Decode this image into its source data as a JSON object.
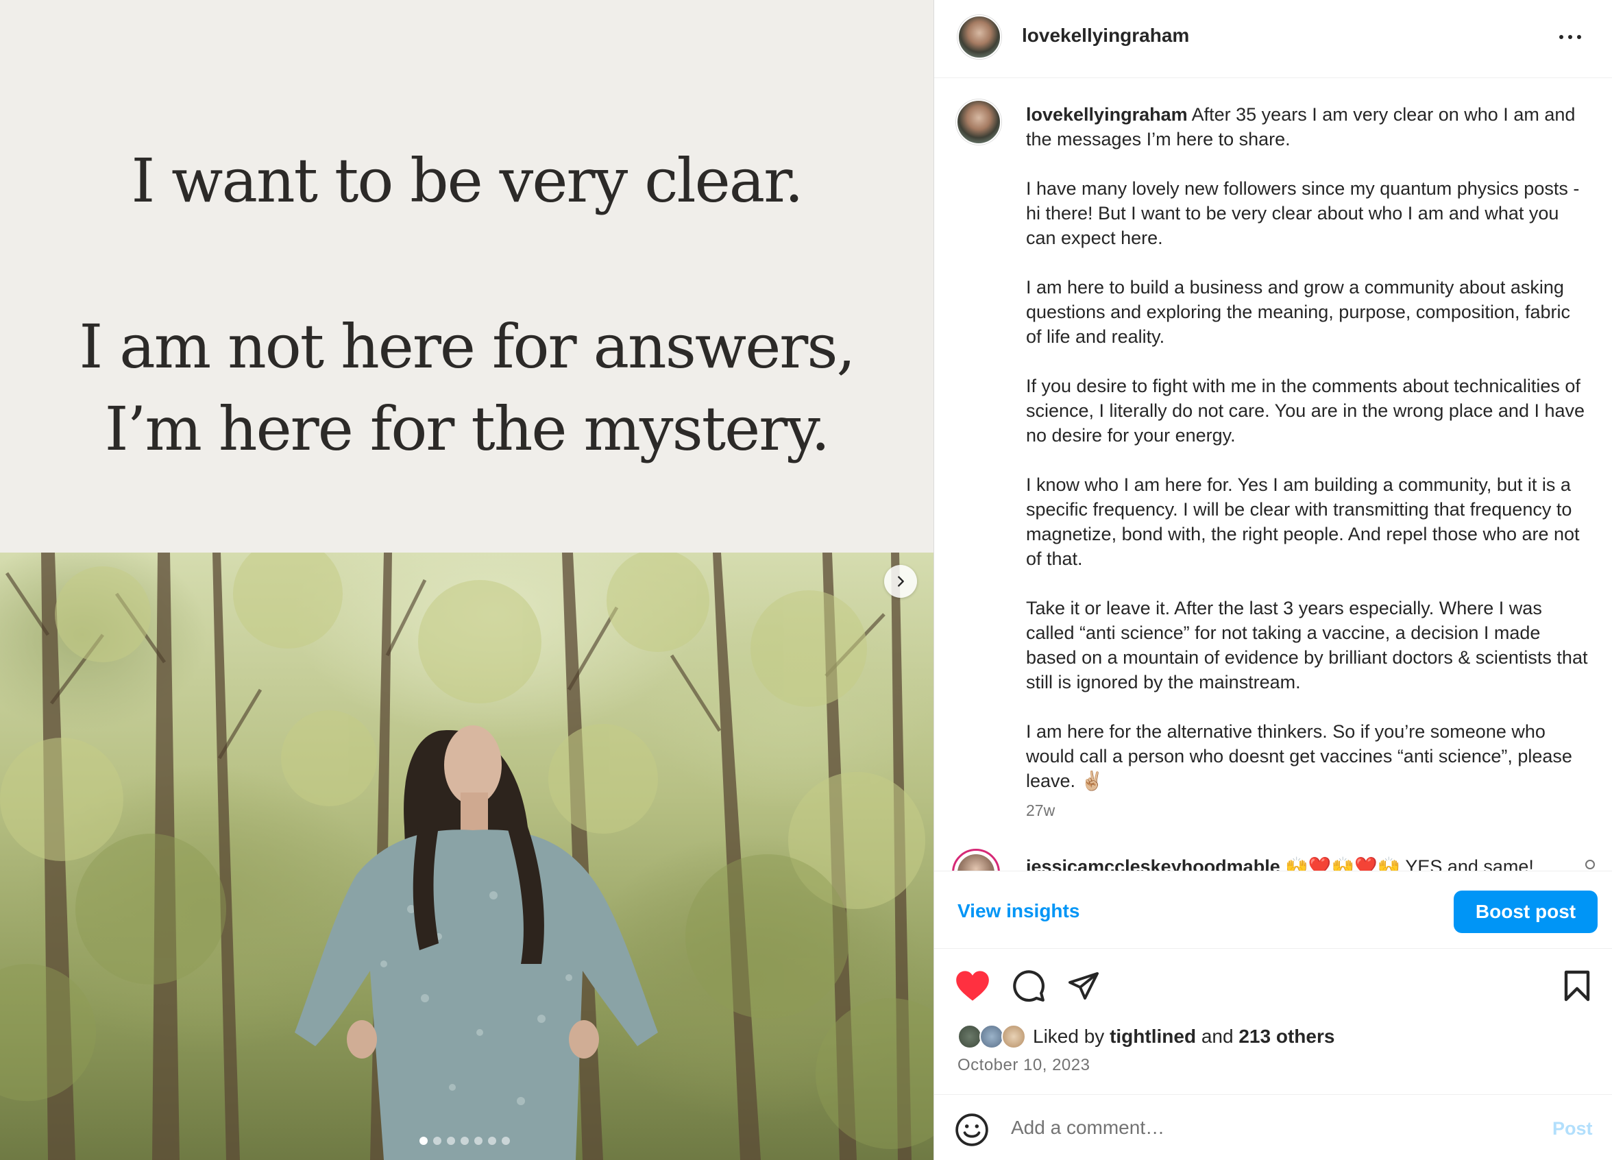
{
  "media": {
    "quote_line_1": "I want to be very clear.",
    "quote_line_2": "I am not here for answers,",
    "quote_line_3": "I’m here for the mystery.",
    "next_icon": "chevron-right-icon",
    "carousel_dots": 7,
    "carousel_active_index": 0
  },
  "header": {
    "username": "lovekellyingraham",
    "more_icon": "more-horizontal-icon"
  },
  "caption": {
    "username": "lovekellyingraham",
    "text": " After 35 years I am very clear on who I am and the messages I’m here to share.\n\nI have many lovely new followers since my quantum physics posts - hi there! But I want to be very clear about who I am and what you can expect here.\n\nI am here to build a business and grow a community about asking questions and exploring the meaning, purpose, composition, fabric of life and reality.\n\nIf you desire to fight with me in the comments about technicalities of science, I literally do not care. You are in the wrong place and I have no desire for your energy.\n\nI know who I am here for. Yes I am building a community, but it is a specific frequency. I will be clear with transmitting that frequency to magnetize, bond with, the right people. And repel those who are not of that.\n\nTake it or leave it. After the last 3 years especially. Where I was called “anti science” for not taking a vaccine, a decision I made based on a mountain of evidence by brilliant doctors & scientists that still is ignored by the mainstream.\n\nI am here for the alternative thinkers. So if you’re someone who would call a person who doesnt get vaccines “anti science”, please leave. ✌🏼",
    "time_ago": "27w"
  },
  "first_comment": {
    "username": "jessicamccleskeyhoodmable",
    "text": " 🙌❤️🙌❤️🙌 YES and same!"
  },
  "actions": {
    "view_insights": "View insights",
    "boost_post": "Boost post",
    "liked_by_prefix": "Liked by ",
    "liked_by_user": "tightlined",
    "liked_by_and": " and ",
    "liked_by_others": "213 others",
    "date": "October 10, 2023"
  },
  "comment_box": {
    "placeholder": "Add a comment…",
    "post_label": "Post"
  },
  "colors": {
    "accent": "#0095f6",
    "like_red": "#ff3040",
    "muted_text": "#737373"
  }
}
